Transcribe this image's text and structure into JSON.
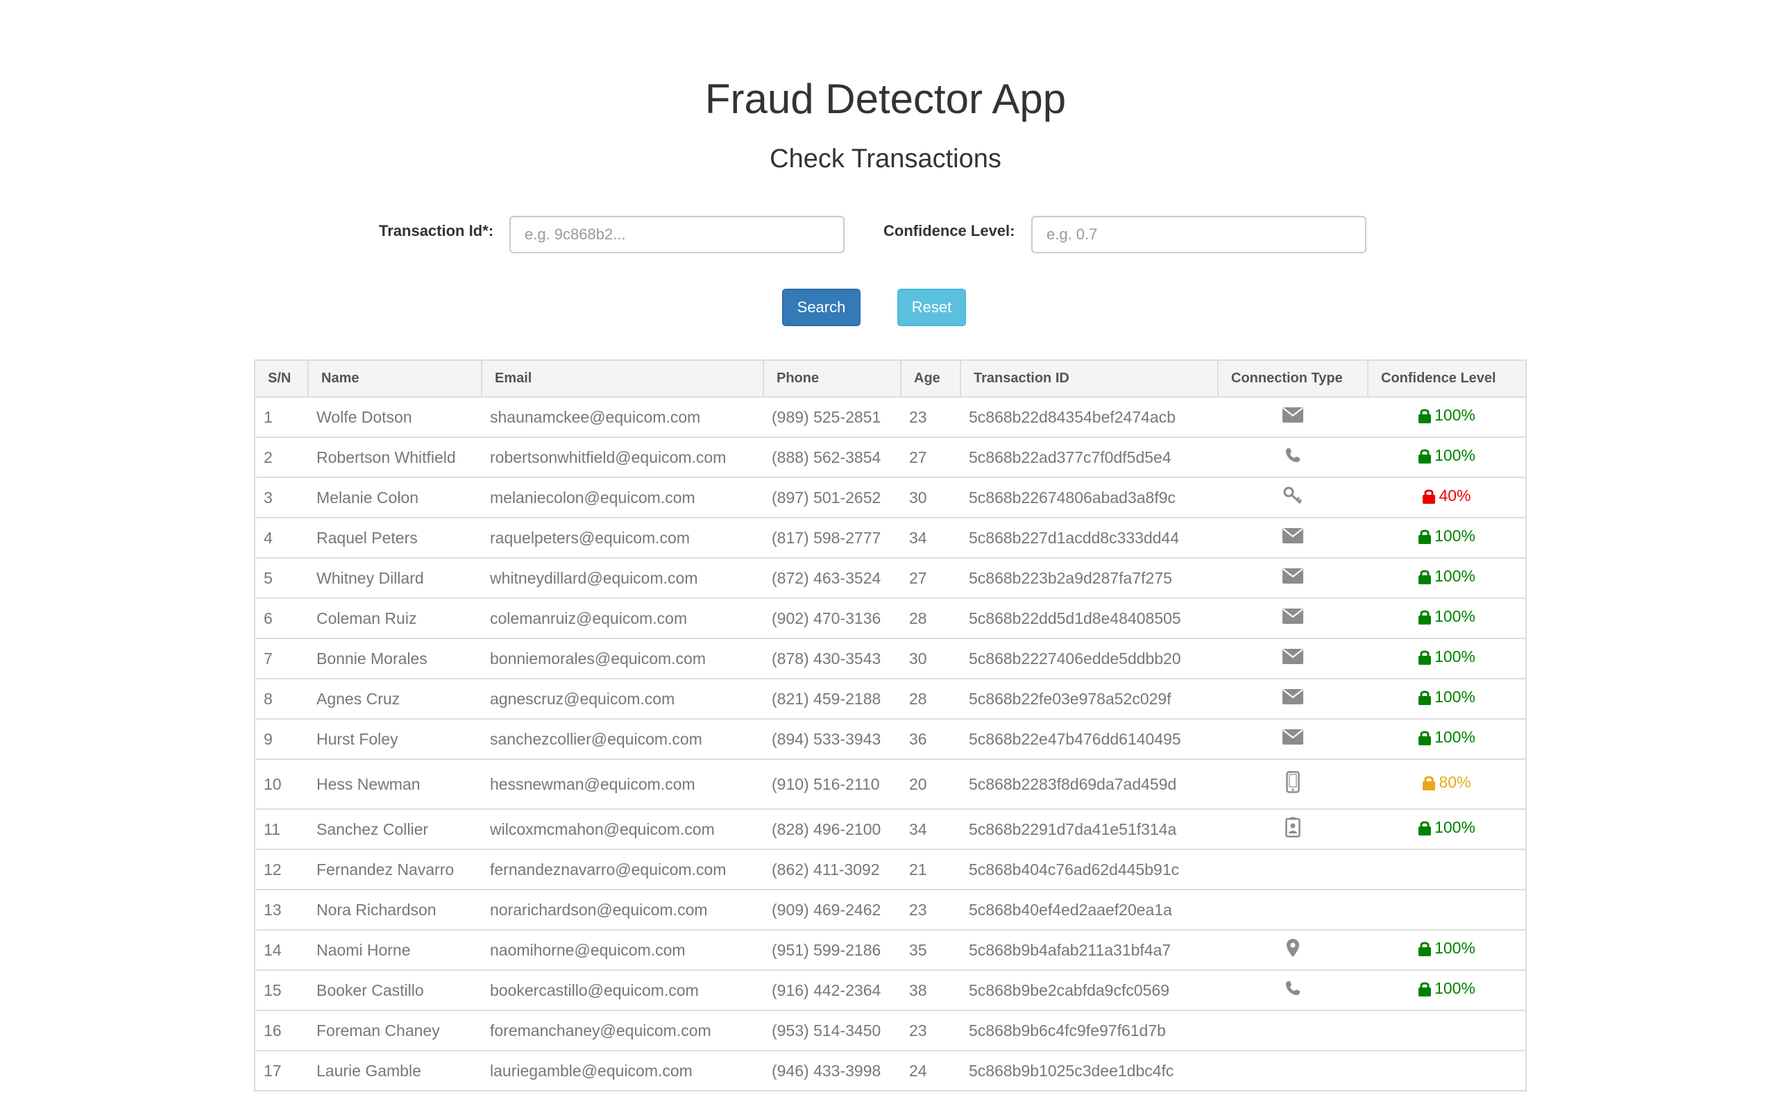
{
  "header": {
    "title": "Fraud Detector App",
    "subtitle": "Check Transactions"
  },
  "form": {
    "transaction_id_label": "Transaction Id*:",
    "transaction_id_placeholder": "e.g. 9c868b2...",
    "transaction_id_value": "",
    "confidence_label": "Confidence Level:",
    "confidence_placeholder": "e.g. 0.7",
    "confidence_value": "",
    "search_label": "Search",
    "reset_label": "Reset"
  },
  "colors": {
    "high": "#008000",
    "medium": "#e6a817",
    "low": "#ee0000",
    "icon": "#8c8c8c"
  },
  "table": {
    "columns": [
      "S/N",
      "Name",
      "Email",
      "Phone",
      "Age",
      "Transaction ID",
      "Connection Type",
      "Confidence Level"
    ],
    "rows": [
      {
        "sn": "1",
        "name": "Wolfe Dotson",
        "email": "shaunamckee@equicom.com",
        "phone": "(989) 525-2851",
        "age": "23",
        "txn": "5c868b22d84354bef2474acb",
        "conn": "envelope-icon",
        "conf": "100%",
        "level": "high"
      },
      {
        "sn": "2",
        "name": "Robertson Whitfield",
        "email": "robertsonwhitfield@equicom.com",
        "phone": "(888) 562-3854",
        "age": "27",
        "txn": "5c868b22ad377c7f0df5d5e4",
        "conn": "phone-icon",
        "conf": "100%",
        "level": "high"
      },
      {
        "sn": "3",
        "name": "Melanie Colon",
        "email": "melaniecolon@equicom.com",
        "phone": "(897) 501-2652",
        "age": "30",
        "txn": "5c868b22674806abad3a8f9c",
        "conn": "key-icon",
        "conf": "40%",
        "level": "low"
      },
      {
        "sn": "4",
        "name": "Raquel Peters",
        "email": "raquelpeters@equicom.com",
        "phone": "(817) 598-2777",
        "age": "34",
        "txn": "5c868b227d1acdd8c333dd44",
        "conn": "envelope-icon",
        "conf": "100%",
        "level": "high"
      },
      {
        "sn": "5",
        "name": "Whitney Dillard",
        "email": "whitneydillard@equicom.com",
        "phone": "(872) 463-3524",
        "age": "27",
        "txn": "5c868b223b2a9d287fa7f275",
        "conn": "envelope-icon",
        "conf": "100%",
        "level": "high"
      },
      {
        "sn": "6",
        "name": "Coleman Ruiz",
        "email": "colemanruiz@equicom.com",
        "phone": "(902) 470-3136",
        "age": "28",
        "txn": "5c868b22dd5d1d8e48408505",
        "conn": "envelope-icon",
        "conf": "100%",
        "level": "high"
      },
      {
        "sn": "7",
        "name": "Bonnie Morales",
        "email": "bonniemorales@equicom.com",
        "phone": "(878) 430-3543",
        "age": "30",
        "txn": "5c868b2227406edde5ddbb20",
        "conn": "envelope-icon",
        "conf": "100%",
        "level": "high"
      },
      {
        "sn": "8",
        "name": "Agnes Cruz",
        "email": "agnescruz@equicom.com",
        "phone": "(821) 459-2188",
        "age": "28",
        "txn": "5c868b22fe03e978a52c029f",
        "conn": "envelope-icon",
        "conf": "100%",
        "level": "high"
      },
      {
        "sn": "9",
        "name": "Hurst Foley",
        "email": "sanchezcollier@equicom.com",
        "phone": "(894) 533-3943",
        "age": "36",
        "txn": "5c868b22e47b476dd6140495",
        "conn": "envelope-icon",
        "conf": "100%",
        "level": "high"
      },
      {
        "sn": "10",
        "name": "Hess Newman",
        "email": "hessnewman@equicom.com",
        "phone": "(910) 516-2110",
        "age": "20",
        "txn": "5c868b2283f8d69da7ad459d",
        "conn": "mobile-icon",
        "conf": "80%",
        "level": "medium"
      },
      {
        "sn": "11",
        "name": "Sanchez Collier",
        "email": "wilcoxmcmahon@equicom.com",
        "phone": "(828) 496-2100",
        "age": "34",
        "txn": "5c868b2291d7da41e51f314a",
        "conn": "id-badge-icon",
        "conf": "100%",
        "level": "high"
      },
      {
        "sn": "12",
        "name": "Fernandez Navarro",
        "email": "fernandeznavarro@equicom.com",
        "phone": "(862) 411-3092",
        "age": "21",
        "txn": "5c868b404c76ad62d445b91c",
        "conn": "",
        "conf": "",
        "level": ""
      },
      {
        "sn": "13",
        "name": "Nora Richardson",
        "email": "norarichardson@equicom.com",
        "phone": "(909) 469-2462",
        "age": "23",
        "txn": "5c868b40ef4ed2aaef20ea1a",
        "conn": "",
        "conf": "",
        "level": ""
      },
      {
        "sn": "14",
        "name": "Naomi Horne",
        "email": "naomihorne@equicom.com",
        "phone": "(951) 599-2186",
        "age": "35",
        "txn": "5c868b9b4afab211a31bf4a7",
        "conn": "map-marker-icon",
        "conf": "100%",
        "level": "high"
      },
      {
        "sn": "15",
        "name": "Booker Castillo",
        "email": "bookercastillo@equicom.com",
        "phone": "(916) 442-2364",
        "age": "38",
        "txn": "5c868b9be2cabfda9cfc0569",
        "conn": "phone-icon",
        "conf": "100%",
        "level": "high"
      },
      {
        "sn": "16",
        "name": "Foreman Chaney",
        "email": "foremanchaney@equicom.com",
        "phone": "(953) 514-3450",
        "age": "23",
        "txn": "5c868b9b6c4fc9fe97f61d7b",
        "conn": "",
        "conf": "",
        "level": ""
      },
      {
        "sn": "17",
        "name": "Laurie Gamble",
        "email": "lauriegamble@equicom.com",
        "phone": "(946) 433-3998",
        "age": "24",
        "txn": "5c868b9b1025c3dee1dbc4fc",
        "conn": "",
        "conf": "",
        "level": ""
      }
    ]
  }
}
